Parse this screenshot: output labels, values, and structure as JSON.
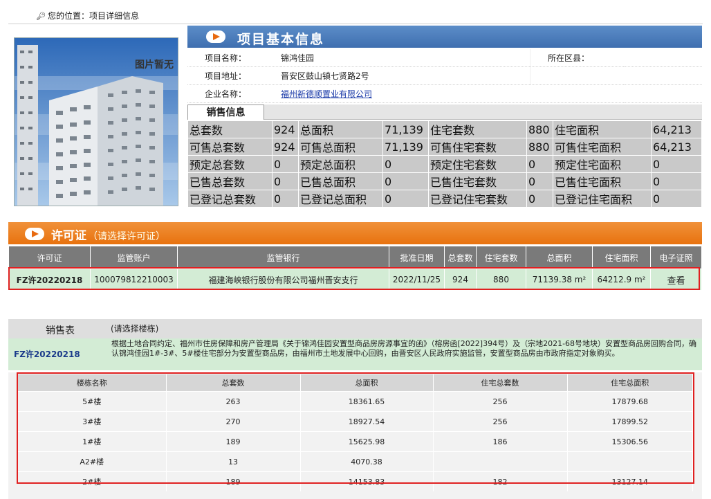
{
  "breadcrumb": {
    "label": "您的位置：",
    "current": "项目详细信息"
  },
  "photo": {
    "placeholder": "图片暂无"
  },
  "project": {
    "title": "项目基本信息",
    "name_label": "项目名称：",
    "name": "锦鸿佳园",
    "district_label": "所在区县：",
    "district": "",
    "address_label": "项目地址：",
    "address": "晋安区鼓山镇七贤路2号",
    "company_label": "企业名称：",
    "company": "福州新德顺置业有限公司"
  },
  "sales": {
    "tab": "销售信息",
    "rows": [
      [
        "总套数",
        "924",
        "总面积",
        "71,139",
        "住宅套数",
        "880",
        "住宅面积",
        "64,213"
      ],
      [
        "可售总套数",
        "924",
        "可售总面积",
        "71,139",
        "可售住宅套数",
        "880",
        "可售住宅面积",
        "64,213"
      ],
      [
        "预定总套数",
        "0",
        "预定总面积",
        "0",
        "预定住宅套数",
        "0",
        "预定住宅面积",
        "0"
      ],
      [
        "已售总套数",
        "0",
        "已售总面积",
        "0",
        "已售住宅套数",
        "0",
        "已售住宅面积",
        "0"
      ],
      [
        "已登记总套数",
        "0",
        "已登记总面积",
        "0",
        "已登记住宅套数",
        "0",
        "已登记住宅面积",
        "0"
      ]
    ]
  },
  "permit": {
    "title": "许可证",
    "subtitle": "（请选择许可证）",
    "headers": [
      "许可证",
      "监管账户",
      "监管银行",
      "批准日期",
      "总套数",
      "住宅套数",
      "总面积",
      "住宅面积",
      "电子证照"
    ],
    "row": {
      "permit": "FZ许20220218",
      "account": "100079812210003",
      "bank": "福建海峡银行股份有限公司福州晋安支行",
      "date": "2022/11/25",
      "total": "924",
      "res": "880",
      "area": "71139.38 m²",
      "res_area": "64212.9 m²",
      "view": "查看"
    }
  },
  "sales_table": {
    "title": "销售表",
    "hint": "(请选择楼栋)",
    "permit": "FZ许20220218",
    "note": "根据土地合同约定、福州市住房保障和房产管理局《关于锦鸿佳园安置型商品房房源事宜的函》（榕房函[2022]394号）及（宗地2021-68号地块）安置型商品房回购合同，确认锦鸿佳园1#-3#、5#楼住宅部分为安置型商品房，由福州市土地发展中心回购，由晋安区人民政府实施监管，安置型商品房由市政府指定对象购买。",
    "headers": [
      "楼栋名称",
      "总套数",
      "总面积",
      "住宅总套数",
      "住宅总面积"
    ],
    "rows": [
      [
        "5#楼",
        "263",
        "18361.65",
        "256",
        "17879.68"
      ],
      [
        "3#楼",
        "270",
        "18927.54",
        "256",
        "17899.52"
      ],
      [
        "1#楼",
        "189",
        "15625.98",
        "186",
        "15306.56"
      ],
      [
        "A2#楼",
        "13",
        "4070.38",
        "",
        ""
      ],
      [
        "2#楼",
        "189",
        "14153.83",
        "182",
        "13127.14"
      ]
    ]
  }
}
